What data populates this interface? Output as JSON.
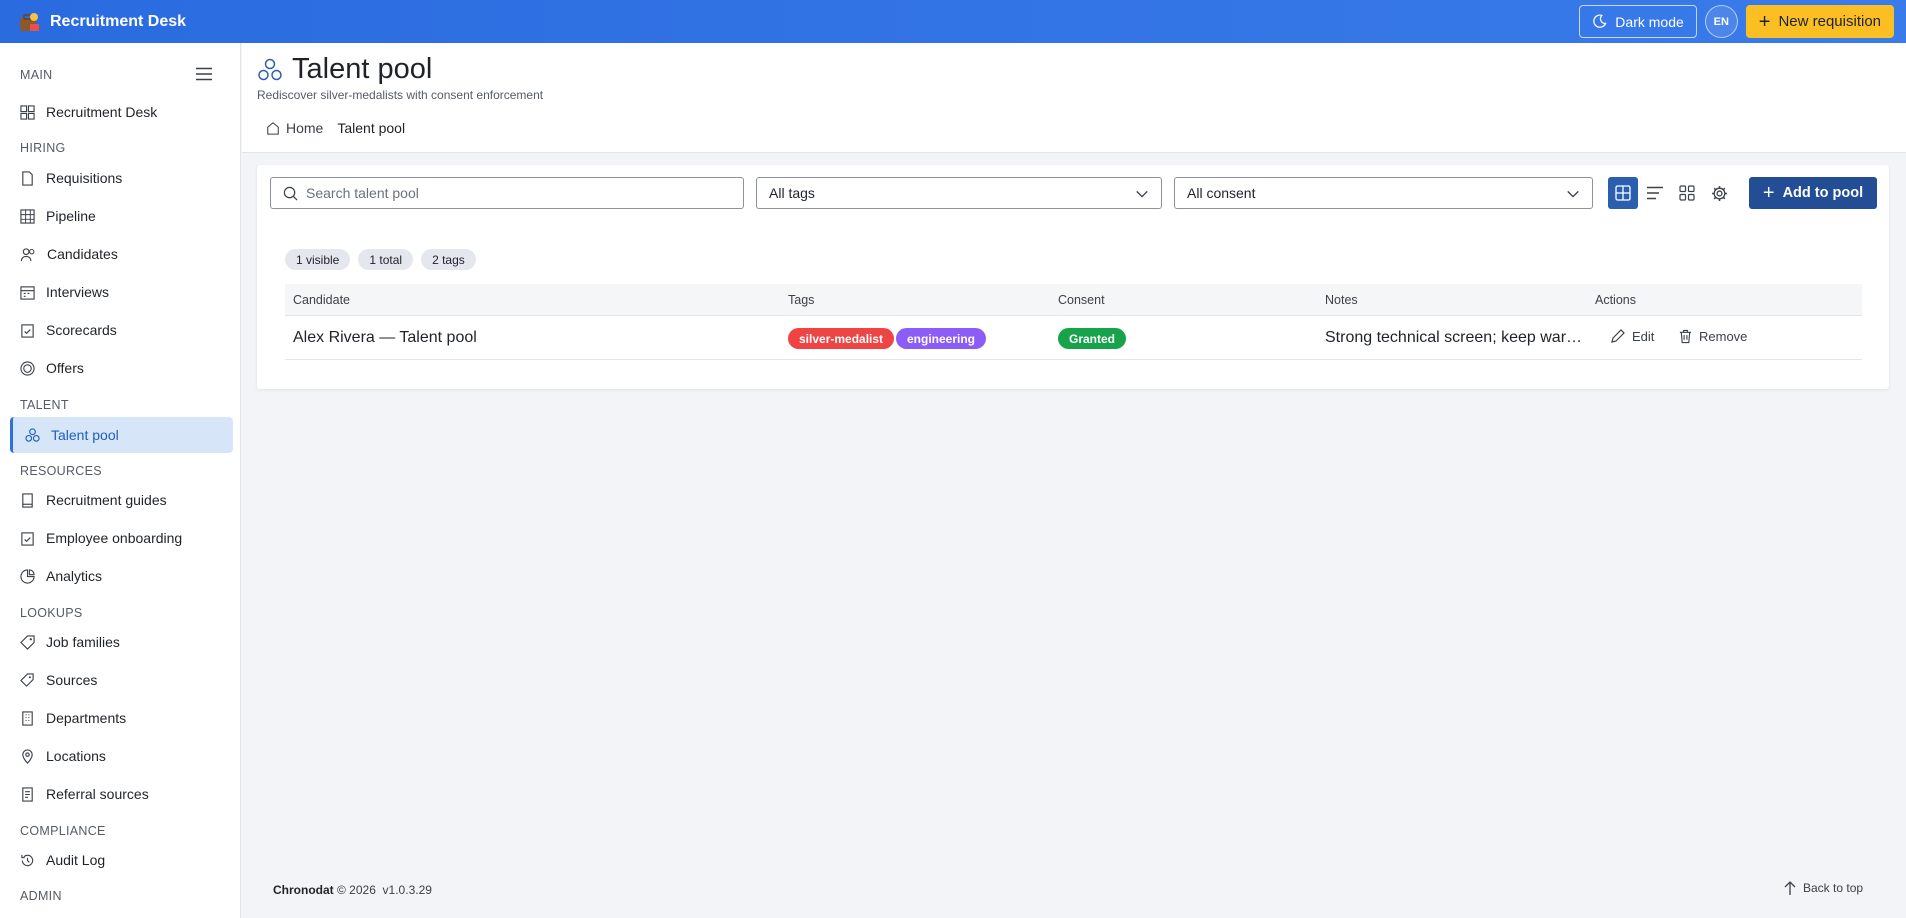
{
  "topbar": {
    "brand": "Recruitment Desk",
    "dark_mode_label": "Dark mode",
    "language": "EN",
    "new_requisition_label": "New requisition"
  },
  "sidebar": {
    "sections": {
      "main": "MAIN",
      "hiring": "HIRING",
      "talent": "TALENT",
      "resources": "RESOURCES",
      "lookups": "LOOKUPS",
      "compliance": "COMPLIANCE",
      "admin": "ADMIN"
    },
    "items": {
      "recruitment_desk": "Recruitment Desk",
      "requisitions": "Requisitions",
      "pipeline": "Pipeline",
      "candidates": "Candidates",
      "interviews": "Interviews",
      "scorecards": "Scorecards",
      "offers": "Offers",
      "talent_pool": "Talent pool",
      "recruitment_guides": "Recruitment guides",
      "employee_onboarding": "Employee onboarding",
      "analytics": "Analytics",
      "job_families": "Job families",
      "sources": "Sources",
      "departments": "Departments",
      "locations": "Locations",
      "referral_sources": "Referral sources",
      "audit_log": "Audit Log"
    },
    "active_item": "talent_pool"
  },
  "header": {
    "title": "Talent pool",
    "subtitle": "Rediscover silver-medalists with consent enforcement",
    "breadcrumb": {
      "home": "Home",
      "current": "Talent pool"
    }
  },
  "toolbar": {
    "search_placeholder": "Search talent pool",
    "tags_filter": "All tags",
    "consent_filter": "All consent",
    "add_label": "Add to pool"
  },
  "chips": {
    "visible": "1 visible",
    "total": "1 total",
    "tags": "2 tags"
  },
  "table": {
    "columns": {
      "candidate": "Candidate",
      "tags": "Tags",
      "consent": "Consent",
      "notes": "Notes",
      "actions": "Actions"
    },
    "rows": [
      {
        "candidate": "Alex Rivera — Talent pool",
        "tags": [
          {
            "label": "silver-medalist",
            "color": "#ef4444"
          },
          {
            "label": "engineering",
            "color": "#8b5cf6"
          }
        ],
        "consent": "Granted",
        "notes": "Strong technical screen; keep warm for future roles",
        "edit_label": "Edit",
        "remove_label": "Remove"
      }
    ]
  },
  "footer": {
    "company": "Chronodat",
    "copyright": "© 2026",
    "version": "v1.0.3.29",
    "back_to_top": "Back to top"
  },
  "colors": {
    "topbar": "#2f6fe3",
    "accent": "#234e96",
    "new_button": "#fbbf24",
    "granted": "#16a34a"
  }
}
